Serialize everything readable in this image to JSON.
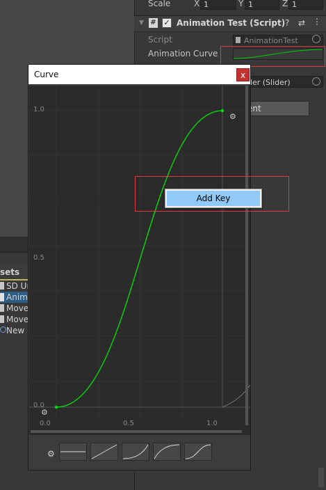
{
  "inspector": {
    "scale_label": "Scale",
    "scale_x_label": "X",
    "scale_x_value": "1",
    "scale_y_label": "Y",
    "scale_y_value": "1",
    "scale_z_label": "Z",
    "scale_z_value": "1",
    "component_title": "Animation Test (Script)",
    "script_label": "Script",
    "script_value": "AnimationTest",
    "curve_label": "Animation Curve",
    "slider_value": "der (Slider)",
    "button_label": "ent"
  },
  "project": {
    "header": "sets",
    "items": [
      "SD Ur",
      "Anima",
      "Move",
      "Move",
      "New N"
    ]
  },
  "curve_window": {
    "title": "Curve",
    "close_label": "x",
    "y_ticks": [
      "1.0",
      "0.5",
      "0.0"
    ],
    "x_ticks": [
      "0.0",
      "0.5",
      "1.0"
    ]
  },
  "context_menu": {
    "item": "Add Key"
  },
  "colors": {
    "curve": "#00e600",
    "highlight": "#e0393e",
    "menu_selected": "#91c9f7"
  }
}
